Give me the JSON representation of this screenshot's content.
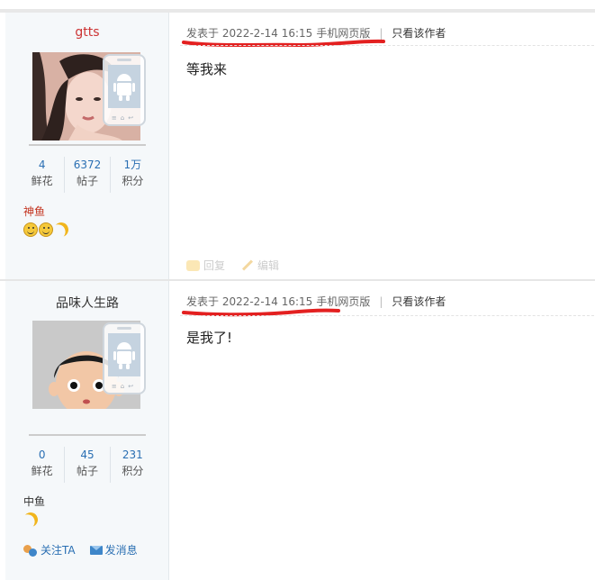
{
  "posts": [
    {
      "username": "gtts",
      "stats": [
        {
          "value": "4",
          "label": "鲜花"
        },
        {
          "value": "6372",
          "label": "帖子"
        },
        {
          "value": "1万",
          "label": "积分"
        }
      ],
      "rank": "神鱼",
      "medals": [
        "smile-icon",
        "smile-icon",
        "moon-icon"
      ],
      "meta": {
        "posted": "发表于 2022-2-14 16:15",
        "client": "手机网页版",
        "only_author": "只看该作者"
      },
      "content": "等我来",
      "actions": {
        "reply": "回复",
        "edit": "编辑"
      }
    },
    {
      "username": "品味人生路",
      "stats": [
        {
          "value": "0",
          "label": "鲜花"
        },
        {
          "value": "45",
          "label": "帖子"
        },
        {
          "value": "231",
          "label": "积分"
        }
      ],
      "rank": "中鱼",
      "medals": [
        "moon-icon"
      ],
      "meta": {
        "posted": "发表于 2022-2-14 16:15",
        "client": "手机网页版",
        "only_author": "只看该作者"
      },
      "content": "是我了!",
      "user_actions": {
        "follow": "关注TA",
        "message": "发消息"
      }
    }
  ],
  "colors": {
    "stat_number": "#2a6fb3",
    "rank_post1": "#c3321d",
    "underline": "#e32020"
  }
}
